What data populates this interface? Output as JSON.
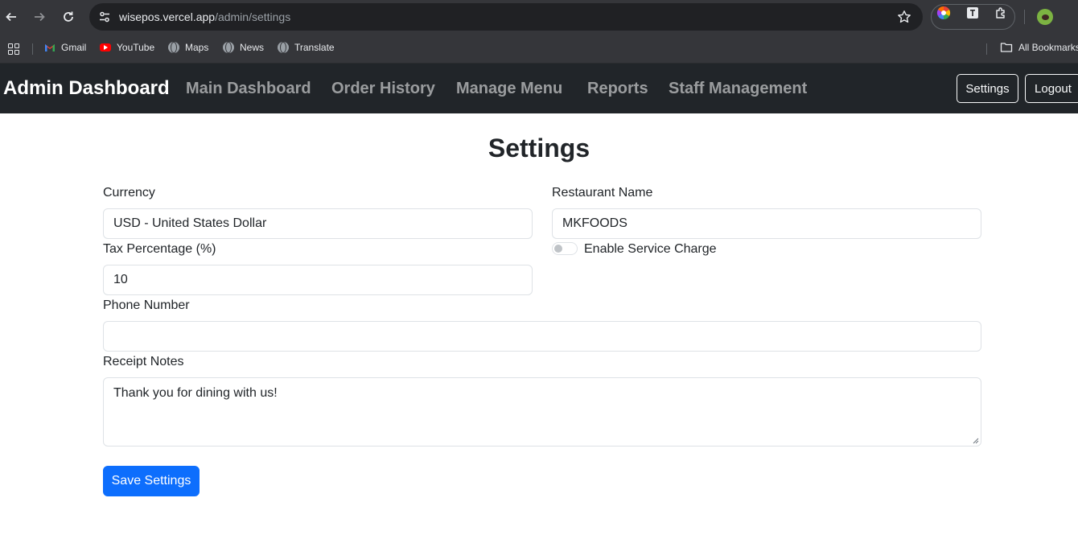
{
  "browser": {
    "url_host": "wisepos.vercel.app",
    "url_path": "/admin/settings",
    "bookmarks": [
      {
        "label": "Gmail",
        "icon": "gmail-icon"
      },
      {
        "label": "YouTube",
        "icon": "youtube-icon"
      },
      {
        "label": "Maps",
        "icon": "globe-icon"
      },
      {
        "label": "News",
        "icon": "globe-icon"
      },
      {
        "label": "Translate",
        "icon": "globe-icon"
      }
    ],
    "all_bookmarks_label": "All Bookmarks"
  },
  "navbar": {
    "brand": "Admin Dashboard",
    "links": [
      "Main Dashboard",
      "Order History",
      "Manage Menu",
      "Reports",
      "Staff Management"
    ],
    "settings_label": "Settings",
    "logout_label": "Logout",
    "background_color": "#212529"
  },
  "page": {
    "title": "Settings"
  },
  "form": {
    "currency": {
      "label": "Currency",
      "value": "USD - United States Dollar"
    },
    "restaurant_name": {
      "label": "Restaurant Name",
      "value": "MKFOODS"
    },
    "service_charge": {
      "label": "Enable Service Charge",
      "enabled": false
    },
    "tax": {
      "label": "Tax Percentage (%)",
      "value": "10"
    },
    "phone": {
      "label": "Phone Number",
      "value": ""
    },
    "receipt_notes": {
      "label": "Receipt Notes",
      "value": "Thank you for dining with us!"
    },
    "save_label": "Save Settings",
    "accent_color": "#0d6efd"
  }
}
